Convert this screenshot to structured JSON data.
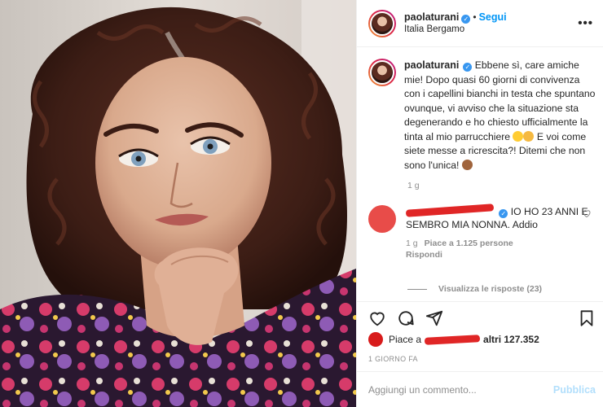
{
  "post": {
    "username": "paolaturani",
    "follow_label": "Segui",
    "separator": "•",
    "location": "Italia Bergamo",
    "more_icon": "•••",
    "caption_text_a": "Ebbene sì, care amiche mie! Dopo quasi 60 giorni di convivenza con i capellini bianchi in testa che spuntano ovunque, vi avviso che la situazione sta degenerando e ho chiesto ufficialmente la tinta al mio parrucchiere ",
    "caption_text_b": " E voi come siete messe a ricrescita?! Ditemi che non sono l'unica! ",
    "caption_time": "1 g"
  },
  "comment": {
    "text": "IO HO 23 ANNI E SEMBRO MIA NONNA. Addio",
    "time": "1 g",
    "likes": "Piace a 1.125 persone",
    "reply_label": "Rispondi",
    "view_replies": "Visualizza le risposte (23)"
  },
  "likes": {
    "prefix": "Piace a",
    "suffix": "altri 127.352"
  },
  "date_label": "1 GIORNO FA",
  "add_comment": {
    "placeholder": "Aggiungi un commento...",
    "post_label": "Pubblica"
  },
  "icons": {
    "like": "heart-icon",
    "comment": "comment-bubble-icon",
    "share": "paper-plane-icon",
    "save": "bookmark-icon"
  },
  "colors": {
    "accent": "#0095f6",
    "verified": "#3897f0",
    "muted": "#8e8e8e"
  }
}
